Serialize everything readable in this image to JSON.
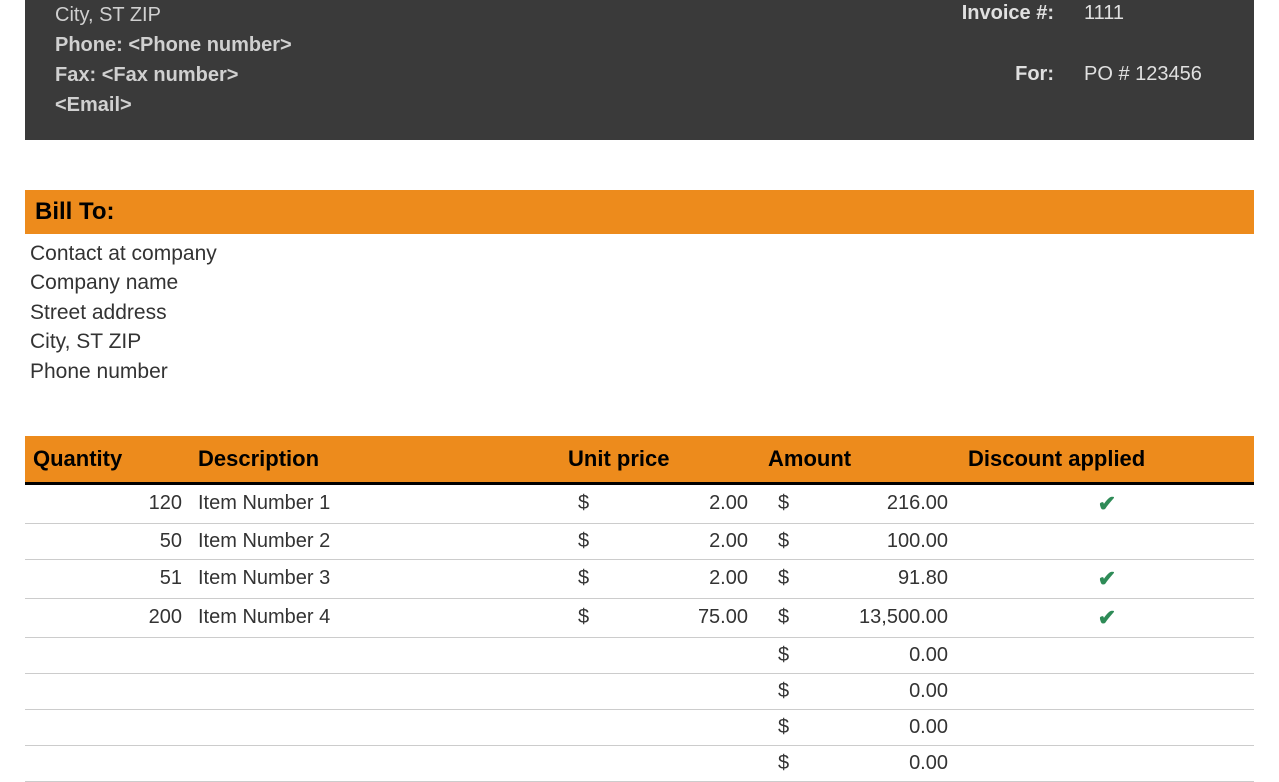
{
  "header": {
    "city_line": "City, ST  ZIP",
    "phone_label": "Phone:",
    "phone_value": "<Phone number>",
    "fax_label": "Fax:",
    "fax_value": "<Fax number>",
    "email": "<Email>",
    "invoice_label": "Invoice #:",
    "invoice_value": "1111",
    "for_label": "For:",
    "for_value": "PO # 123456"
  },
  "billto": {
    "title": "Bill To:",
    "lines": [
      "Contact at company",
      "Company name",
      "Street address",
      "City, ST  ZIP",
      "Phone number"
    ]
  },
  "table": {
    "headers": {
      "qty": "Quantity",
      "desc": "Description",
      "unit": "Unit price",
      "amount": "Amount",
      "disc": "Discount applied"
    },
    "rows": [
      {
        "qty": "120",
        "desc": "Item Number 1",
        "unit": "2.00",
        "amount": "216.00",
        "disc": true
      },
      {
        "qty": "50",
        "desc": "Item Number 2",
        "unit": "2.00",
        "amount": "100.00",
        "disc": false
      },
      {
        "qty": "51",
        "desc": "Item Number 3",
        "unit": "2.00",
        "amount": "91.80",
        "disc": true
      },
      {
        "qty": "200",
        "desc": "Item Number 4",
        "unit": "75.00",
        "amount": "13,500.00",
        "disc": true
      },
      {
        "qty": "",
        "desc": "",
        "unit": "",
        "amount": "0.00",
        "disc": false
      },
      {
        "qty": "",
        "desc": "",
        "unit": "",
        "amount": "0.00",
        "disc": false
      },
      {
        "qty": "",
        "desc": "",
        "unit": "",
        "amount": "0.00",
        "disc": false
      },
      {
        "qty": "",
        "desc": "",
        "unit": "",
        "amount": "0.00",
        "disc": false
      }
    ]
  },
  "currency_symbol": "$"
}
